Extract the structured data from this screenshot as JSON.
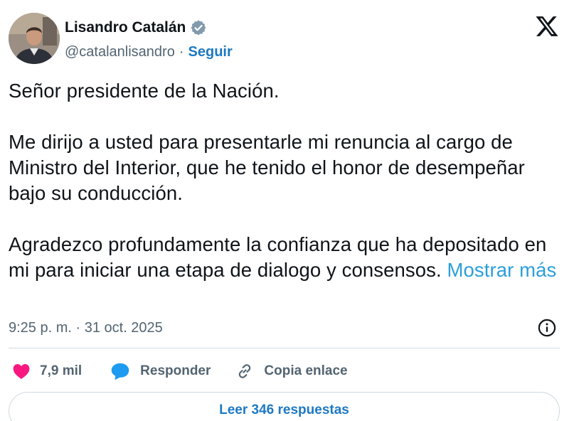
{
  "author": {
    "display_name": "Lisandro Catalán",
    "handle": "@catalanlisandro",
    "follow_label": "Seguir",
    "avatar": "avatar-photo",
    "verified_icon": "verified-badge-icon"
  },
  "brand": {
    "logo": "x-logo-icon"
  },
  "tweet": {
    "paragraphs": [
      "Señor presidente de la Nación.",
      "Me dirijo a usted para presentarle mi renuncia al cargo de Ministro del Interior, que he tenido el honor de desempeñar bajo su conducción.",
      "Agradezco profundamente la confianza que ha depositado en mi para iniciar una etapa de dialogo y consensos."
    ],
    "show_more": "Mostrar más"
  },
  "meta": {
    "timestamp": "9:25 p. m. · 31 oct. 2025",
    "info_icon": "info-icon"
  },
  "actions": {
    "like_count": "7,9 mil",
    "reply_label": "Responder",
    "copy_label": "Copia enlace"
  },
  "footer": {
    "read_replies": "Leer 346 respuestas"
  },
  "colors": {
    "accent": "#1d79c2",
    "link": "#2b9fd9",
    "like": "#f91880",
    "reply": "#1d9bf0",
    "muted": "#536471",
    "text": "#0f1419"
  }
}
